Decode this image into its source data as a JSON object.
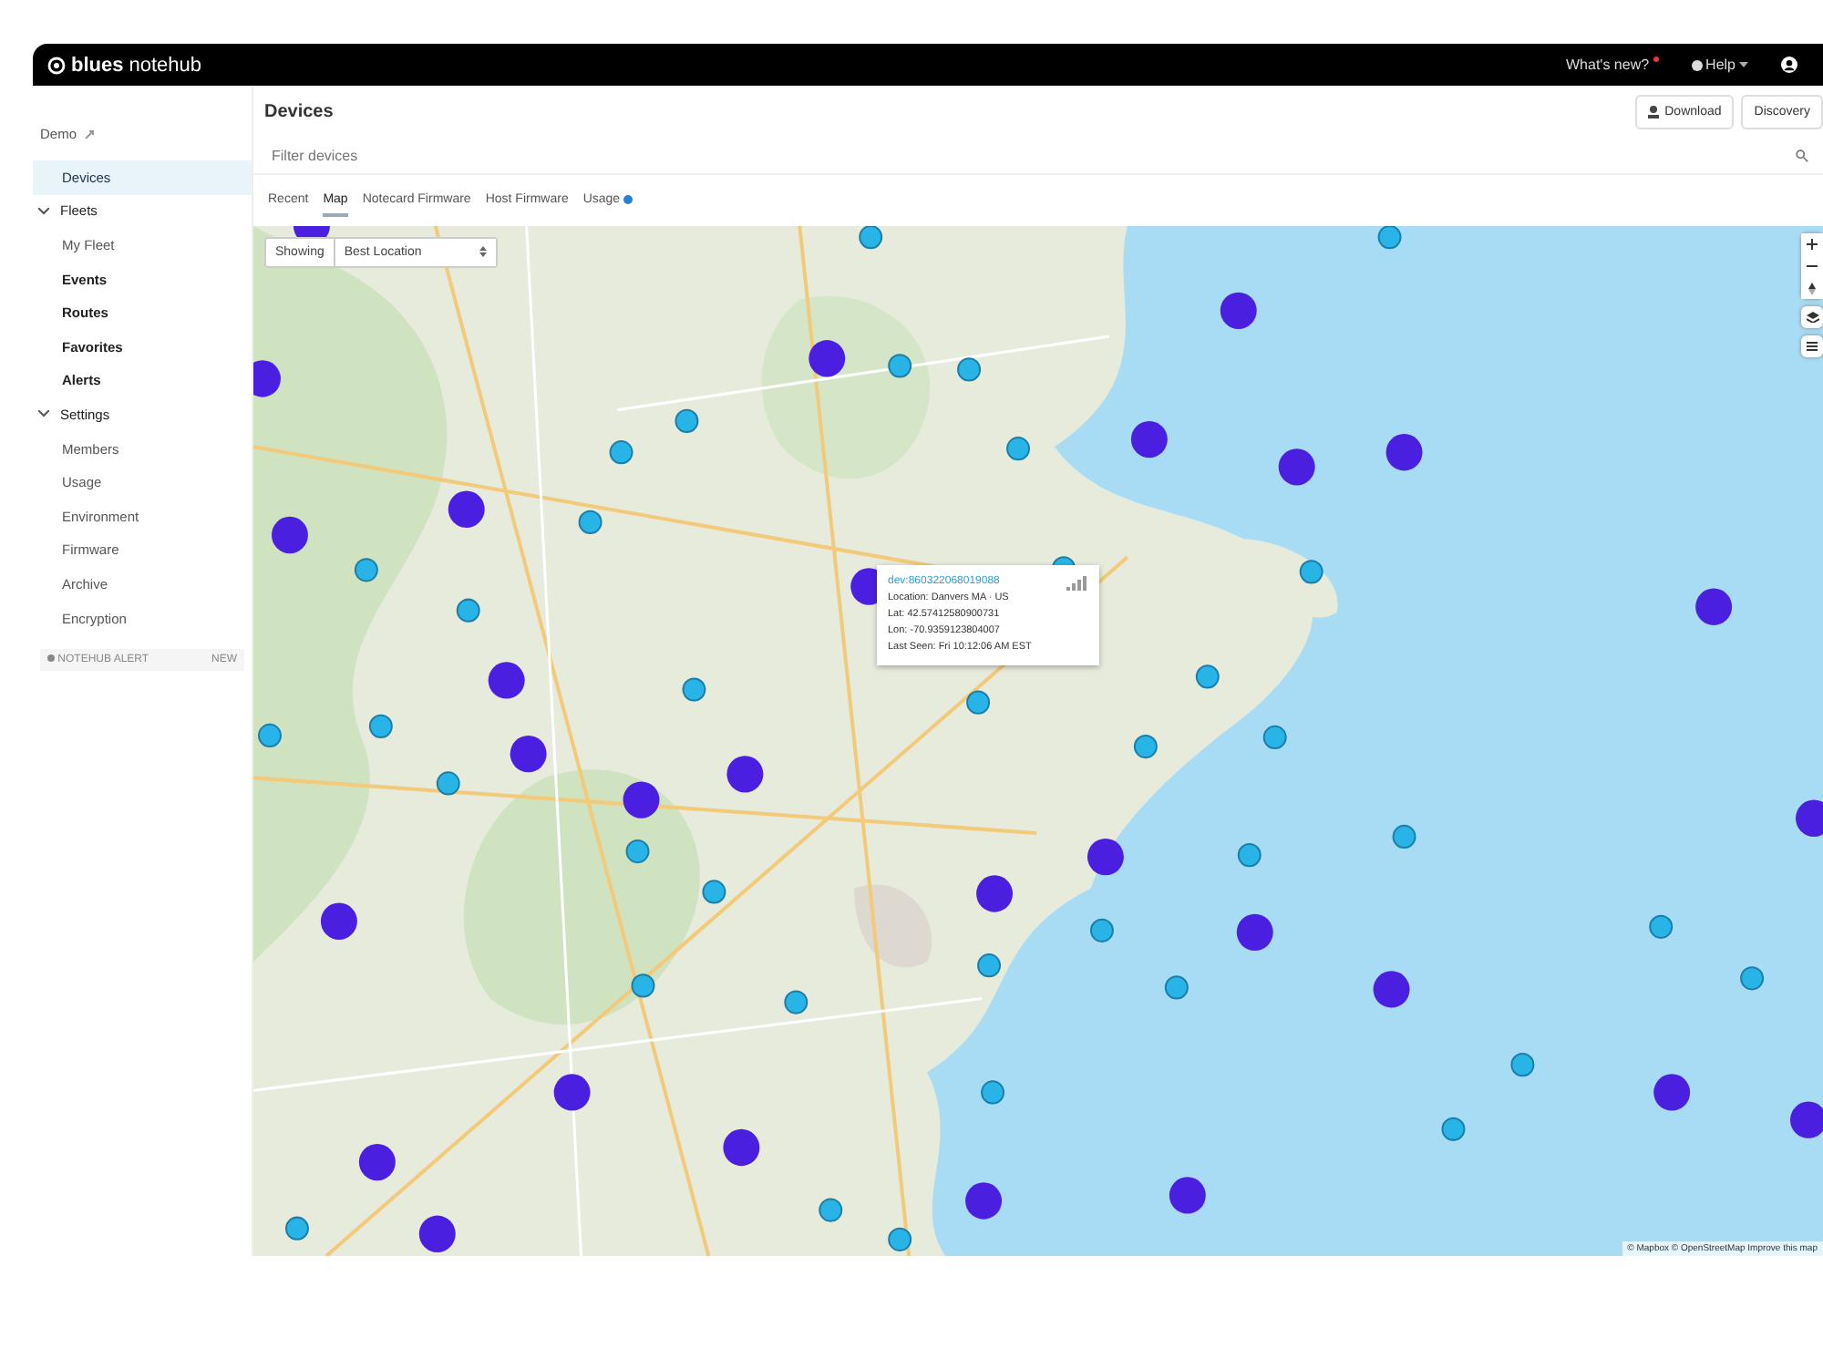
{
  "topbar": {
    "brand": "blues",
    "product": "notehub",
    "links": [
      {
        "label": "What's new?",
        "kind": "badge"
      },
      {
        "label": "Help",
        "kind": "menu"
      }
    ]
  },
  "sidebar": {
    "project": "Demo",
    "items": [
      {
        "label": "Devices",
        "selected": true,
        "kind": "item"
      },
      {
        "label": "Fleets",
        "selected": false,
        "kind": "group",
        "children": [
          {
            "label": "My Fleet",
            "selected": false
          }
        ]
      },
      {
        "label": "Events",
        "selected": false,
        "kind": "strong"
      },
      {
        "label": "Routes",
        "selected": false,
        "kind": "strong"
      },
      {
        "label": "Favorites",
        "selected": false,
        "kind": "strong"
      },
      {
        "label": "Alerts",
        "selected": false,
        "kind": "strong"
      },
      {
        "label": "Settings",
        "selected": false,
        "kind": "group",
        "children": [
          {
            "label": "Members",
            "selected": false
          },
          {
            "label": "Usage",
            "selected": false
          },
          {
            "label": "Environment",
            "selected": false
          },
          {
            "label": "Firmware",
            "selected": false
          },
          {
            "label": "Archive",
            "selected": false
          },
          {
            "label": "Encryption",
            "selected": false
          }
        ]
      }
    ],
    "footer": {
      "label": "NOTEHUB ALERT",
      "action": "NEW"
    }
  },
  "page": {
    "title": "Devices",
    "buttons": [
      "Download",
      "Discovery"
    ],
    "search": {
      "placeholder": "Filter devices"
    }
  },
  "tabs": [
    {
      "label": "Recent",
      "selected": false
    },
    {
      "label": "Map",
      "selected": true
    },
    {
      "label": "Notecard Firmware",
      "selected": false
    },
    {
      "label": "Host Firmware",
      "selected": false
    },
    {
      "label": "Usage",
      "selected": false
    }
  ],
  "map": {
    "showing_label": "Showing",
    "location_select": "Best Location",
    "popup": {
      "device": "dev:860322068019088",
      "lines": [
        "Location: Danvers MA · US",
        "Lat: 42.57412580900731",
        "Lon: -70.9359123804007",
        "Last Seen: Fri 10:12:06 AM EST"
      ]
    },
    "attribution": "© Mapbox © OpenStreetMap Improve this map"
  }
}
